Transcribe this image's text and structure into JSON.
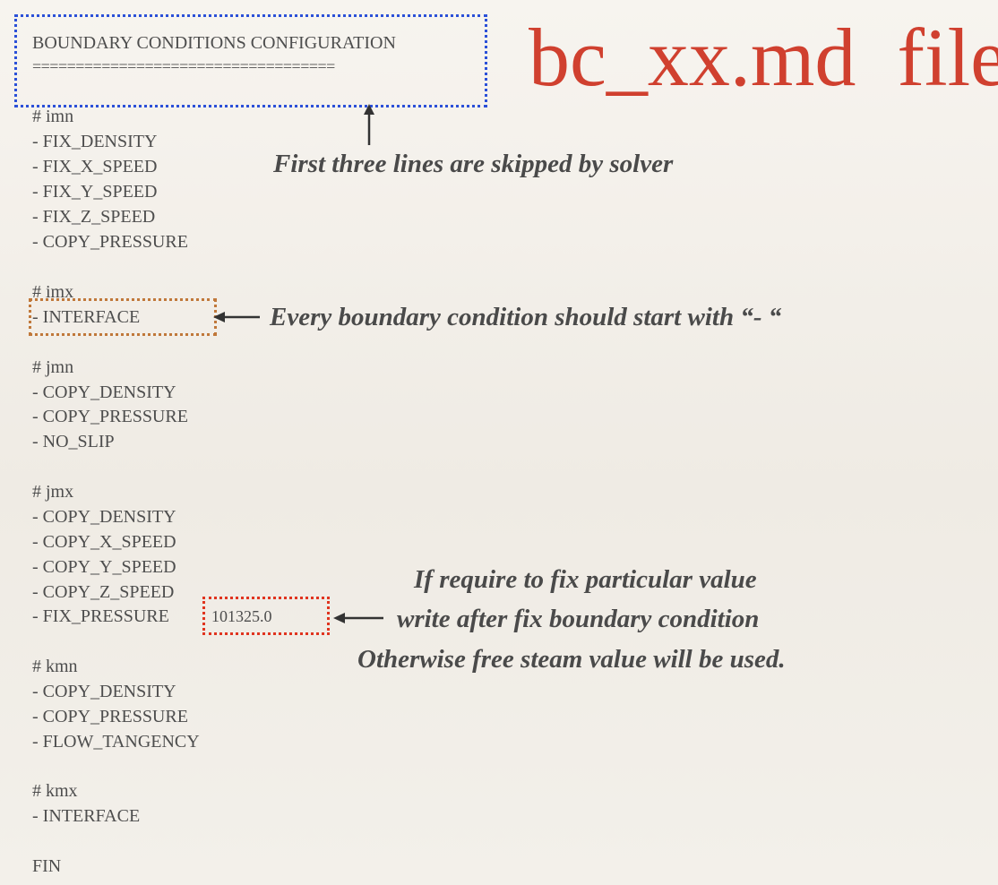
{
  "title": "bc_xx.md  file",
  "file_header": {
    "line1": "BOUNDARY CONDITIONS CONFIGURATION",
    "line2": "==================================="
  },
  "sections": [
    {
      "header": "# imn",
      "items": [
        "- FIX_DENSITY",
        "- FIX_X_SPEED",
        "- FIX_Y_SPEED",
        "- FIX_Z_SPEED",
        "- COPY_PRESSURE"
      ]
    },
    {
      "header": "# imx",
      "items": [
        "- INTERFACE"
      ]
    },
    {
      "header": "# jmn",
      "items": [
        "- COPY_DENSITY",
        "- COPY_PRESSURE",
        "- NO_SLIP"
      ]
    },
    {
      "header": "# jmx",
      "items": [
        "- COPY_DENSITY",
        "- COPY_X_SPEED",
        "- COPY_Y_SPEED",
        "- COPY_Z_SPEED",
        "- FIX_PRESSURE"
      ]
    },
    {
      "header": "# kmn",
      "items": [
        "- COPY_DENSITY",
        "- COPY_PRESSURE",
        "- FLOW_TANGENCY"
      ]
    },
    {
      "header": "# kmx",
      "items": [
        "- INTERFACE"
      ]
    }
  ],
  "fix_value": "101325.0",
  "footer": "FIN",
  "annotations": {
    "skipped": "First three lines are skipped by solver",
    "prefix": "Every boundary condition should start with “- “",
    "fix_line1": "If require to fix particular value",
    "fix_line2": "write after fix boundary condition",
    "fix_line3": "Otherwise free steam value will be used."
  },
  "colors": {
    "title": "#d0402f",
    "header_box": "#2b50d8",
    "interface_box": "#c0783a",
    "value_box": "#e0341f"
  }
}
